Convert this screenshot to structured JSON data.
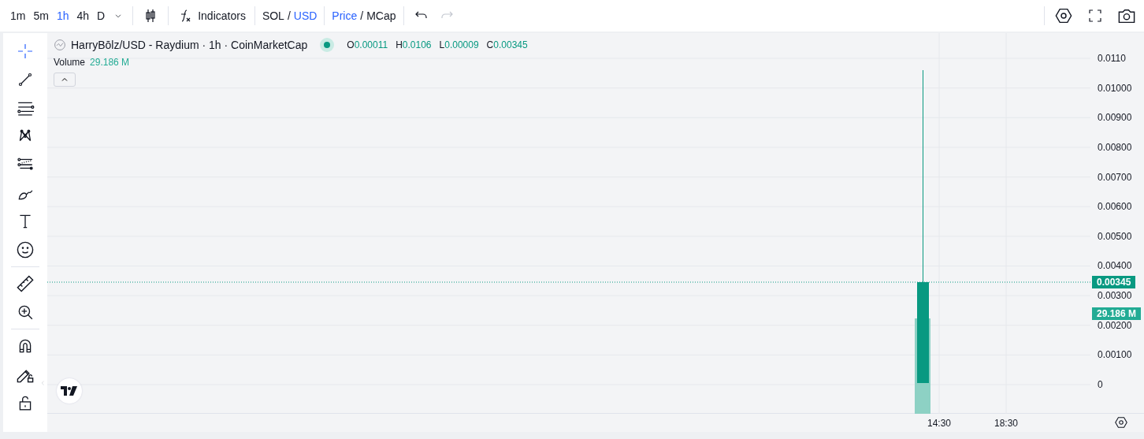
{
  "toolbar": {
    "intervals": [
      {
        "label": "1m",
        "selected": false
      },
      {
        "label": "5m",
        "selected": false
      },
      {
        "label": "1h",
        "selected": true
      },
      {
        "label": "4h",
        "selected": false
      },
      {
        "label": "D",
        "selected": false
      }
    ],
    "indicators": "Indicators",
    "currency": {
      "options": [
        {
          "label": "SOL",
          "selected": false
        },
        {
          "label": "USD",
          "selected": true
        }
      ],
      "separator": "/"
    },
    "mode": {
      "options": [
        {
          "label": "Price",
          "selected": true
        },
        {
          "label": "MCap",
          "selected": false
        }
      ],
      "separator": "/"
    },
    "redo_disabled": true
  },
  "tools": [
    [
      {
        "kind": "crosshair",
        "selected": true
      },
      {
        "kind": "trendline",
        "selected": false
      },
      {
        "kind": "fib",
        "selected": false
      },
      {
        "kind": "pattern",
        "selected": false
      },
      {
        "kind": "forecast",
        "selected": false
      },
      {
        "kind": "brush",
        "selected": false
      },
      {
        "kind": "text",
        "selected": false
      },
      {
        "kind": "emoji",
        "selected": false
      }
    ],
    [
      {
        "kind": "ruler",
        "selected": false
      },
      {
        "kind": "zoom",
        "selected": false
      }
    ],
    [
      {
        "kind": "magnet",
        "selected": false
      },
      {
        "kind": "lock-drawings",
        "selected": false
      },
      {
        "kind": "lock",
        "selected": false
      }
    ]
  ],
  "legend": {
    "title": "HarryBōlz/USD - Raydium · 1h · CoinMarketCap",
    "live": true,
    "ohlc": [
      {
        "key": "O",
        "value": "0.00011"
      },
      {
        "key": "H",
        "value": "0.0106"
      },
      {
        "key": "L",
        "value": "0.00009"
      },
      {
        "key": "C",
        "value": "0.00345"
      }
    ],
    "volume": {
      "label": "Volume",
      "value": "29.186 M"
    }
  },
  "price_axis": {
    "ticks": [
      "0.0110",
      "0.01000",
      "0.00900",
      "0.00800",
      "0.00700",
      "0.00600",
      "0.00500",
      "0.00400",
      "0.00300",
      "0.00200",
      "0.00100",
      "0"
    ],
    "last_price": "0.00345",
    "volume_value": "29.186 M"
  },
  "time_axis": [
    "14:30",
    "18:30"
  ]
}
